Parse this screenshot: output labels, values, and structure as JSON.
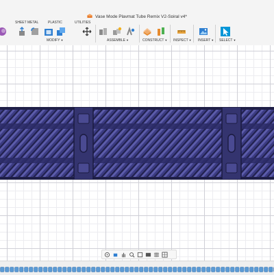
{
  "window": {
    "title": "Vase Mode Playmat Tube Remix V2-Spiral v4*",
    "app_icon": "fusion-doc-icon"
  },
  "toolbar": {
    "tabs": [
      {
        "label": "SHEET METAL"
      },
      {
        "label": "PLASTIC"
      },
      {
        "label": "UTILITIES"
      }
    ],
    "groups": [
      {
        "label": "MODIFY",
        "icons": [
          "press-pull-icon",
          "fillet-icon",
          "shell-icon",
          "combine-icon",
          "move-icon"
        ]
      },
      {
        "label": "ASSEMBLE",
        "icons": [
          "new-component-icon",
          "joint-icon",
          "as-built-joint-icon"
        ]
      },
      {
        "label": "CONSTRUCT",
        "icons": [
          "offset-plane-icon",
          "midplane-icon"
        ]
      },
      {
        "label": "INSPECT",
        "icons": [
          "measure-icon"
        ]
      },
      {
        "label": "INSERT",
        "icons": [
          "insert-image-icon"
        ]
      },
      {
        "label": "SELECT",
        "icons": [
          "select-cursor-icon"
        ]
      }
    ],
    "colors": {
      "accent": "#0696d7",
      "icon_blue": "#2f7fd1",
      "plastic_orange": "#e68a2e"
    }
  },
  "viewport": {
    "model_color": "#3b3b82",
    "model_dark": "#22224f",
    "model_light": "#5c5caa",
    "grid_color": "#cfcfd6"
  },
  "navbar": {
    "icons": [
      "orbit-icon",
      "look-at-icon",
      "pan-icon",
      "zoom-icon",
      "fit-icon",
      "display-settings-icon",
      "grid-settings-icon",
      "viewports-icon"
    ]
  },
  "timeline": {
    "feature_icon": "spiral-feature-icon",
    "feature_color": "#5b9bd5"
  }
}
